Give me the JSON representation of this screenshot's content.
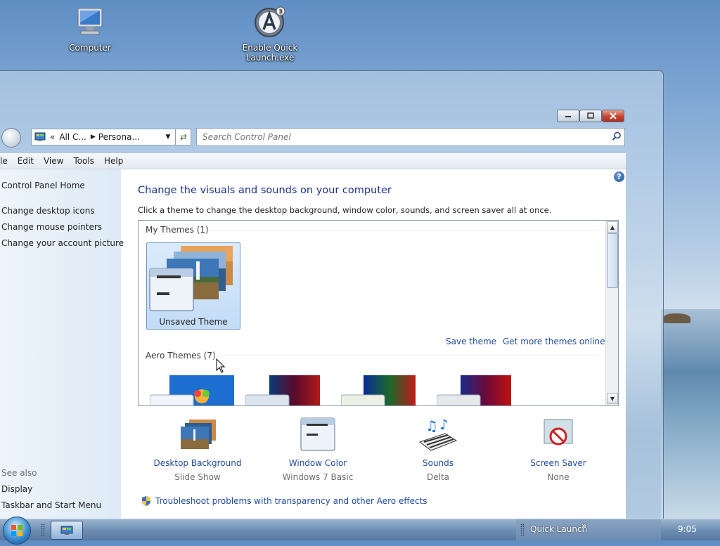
{
  "desktop": {
    "icons": [
      {
        "label": "Computer"
      },
      {
        "label": "Enable Quick Launch.exe"
      }
    ]
  },
  "address_bar": {
    "prefix": "«",
    "seg1": "All C...",
    "seg2": "Persona..."
  },
  "search": {
    "placeholder": "Search Control Panel"
  },
  "menu": [
    "le",
    "Edit",
    "View",
    "Tools",
    "Help"
  ],
  "sidebar": {
    "home": "Control Panel Home",
    "links": [
      "Change desktop icons",
      "Change mouse pointers",
      "Change your account picture"
    ],
    "see_also": "See also",
    "see_also_links": [
      "Display",
      "Taskbar and Start Menu"
    ]
  },
  "main": {
    "title": "Change the visuals and sounds on your computer",
    "description": "Click a theme to change the desktop background, window color, sounds, and screen saver all at once.",
    "my_themes_header": "My Themes (1)",
    "unsaved_theme": "Unsaved Theme",
    "save_theme": "Save theme",
    "get_more": "Get more themes online",
    "aero_header": "Aero Themes (7)"
  },
  "bottom": [
    {
      "title": "Desktop Background",
      "sub": "Slide Show"
    },
    {
      "title": "Window Color",
      "sub": "Windows 7 Basic"
    },
    {
      "title": "Sounds",
      "sub": "Delta"
    },
    {
      "title": "Screen Saver",
      "sub": "None"
    }
  ],
  "troubleshoot": "Troubleshoot problems with transparency and other Aero effects",
  "taskbar": {
    "quick_launch": "Quick Launch",
    "chevron": "»",
    "clock": "9:05"
  },
  "colors": {
    "link": "#1e4b9c",
    "title": "#1e3287",
    "accent": "#3a8ad1"
  }
}
